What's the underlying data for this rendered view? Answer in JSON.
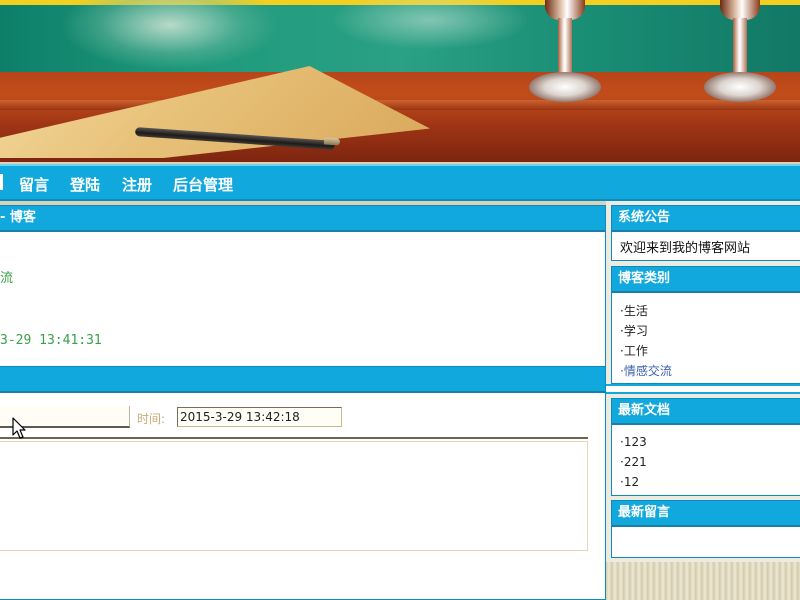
{
  "nav": {
    "items": [
      "留言",
      "登陆",
      "注册",
      "后台管理"
    ]
  },
  "main": {
    "blog_panel_title": "- 博客",
    "category_partial": "流",
    "datetime_partial": "3-29 13:41:31"
  },
  "form": {
    "time_label": "时间:",
    "time_value": "2015-3-29 13:42:18"
  },
  "sidebar": {
    "announcement": {
      "title": "系统公告",
      "text": "欢迎来到我的博客网站"
    },
    "categories": {
      "title": "博客类别",
      "items": [
        "·生活",
        "·学习",
        "·工作",
        "·情感交流"
      ]
    },
    "latest_docs": {
      "title": "最新文档",
      "items": [
        "·123",
        "·221",
        "·12"
      ]
    },
    "latest_messages": {
      "title": "最新留言"
    }
  },
  "colors": {
    "accent": "#11a8dd",
    "link_green": "#3aa04a",
    "banner_yellow": "#f2cf20"
  }
}
